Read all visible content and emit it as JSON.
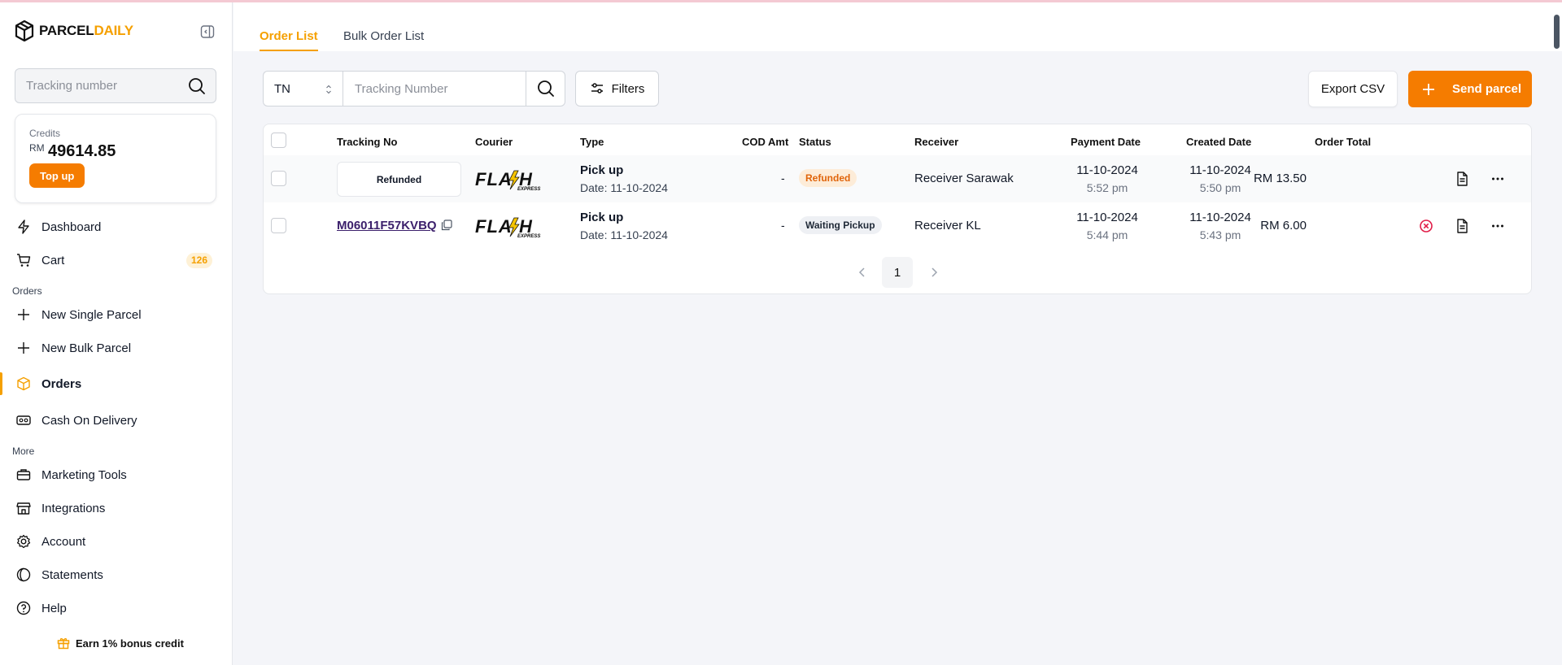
{
  "brand": {
    "part1": "PARCEL",
    "part2": "DAILY"
  },
  "sidebar": {
    "search_placeholder": "Tracking number",
    "credits": {
      "label": "Credits",
      "currency": "RM",
      "amount": "49614.85",
      "topup_label": "Top up"
    },
    "items": [
      {
        "label": "Dashboard",
        "icon": "lightning-icon"
      },
      {
        "label": "Cart",
        "icon": "cart-icon",
        "badge": "126"
      },
      {
        "label": "New Single Parcel",
        "icon": "plus-icon"
      },
      {
        "label": "New Bulk Parcel",
        "icon": "plus-icon"
      },
      {
        "label": "Orders",
        "icon": "box-icon",
        "active": true
      },
      {
        "label": "Cash On Delivery",
        "icon": "cod-icon"
      },
      {
        "label": "Marketing Tools",
        "icon": "briefcase-icon"
      },
      {
        "label": "Integrations",
        "icon": "store-icon"
      },
      {
        "label": "Account",
        "icon": "gear-icon"
      },
      {
        "label": "Statements",
        "icon": "statements-icon"
      },
      {
        "label": "Help",
        "icon": "help-icon"
      }
    ],
    "section_orders": "Orders",
    "section_more": "More",
    "earn_label": "Earn 1% bonus credit"
  },
  "tabs": [
    {
      "label": "Order List",
      "active": true
    },
    {
      "label": "Bulk Order List",
      "active": false
    }
  ],
  "toolbar": {
    "search_type": "TN",
    "search_placeholder": "Tracking Number",
    "filters_label": "Filters",
    "export_label": "Export CSV",
    "send_label": "Send parcel"
  },
  "table": {
    "headers": {
      "tracking": "Tracking No",
      "courier": "Courier",
      "type": "Type",
      "cod": "COD Amt",
      "status": "Status",
      "receiver": "Receiver",
      "payment_date": "Payment Date",
      "created_date": "Created Date",
      "total": "Order Total"
    },
    "rows": [
      {
        "tracking": "Refunded",
        "courier": "FLASH EXPRESS",
        "type": "Pick up",
        "type_date": "Date: 11-10-2024",
        "cod": "-",
        "status": "Refunded",
        "receiver": "Receiver Sarawak",
        "payment_date": "11-10-2024",
        "payment_time": "5:52 pm",
        "created_date": "11-10-2024",
        "created_time": "5:50 pm",
        "total": "RM 13.50"
      },
      {
        "tracking": "M06011F57KVBQ",
        "courier": "FLASH EXPRESS",
        "type": "Pick up",
        "type_date": "Date: 11-10-2024",
        "cod": "-",
        "status": "Waiting Pickup",
        "receiver": "Receiver KL",
        "payment_date": "11-10-2024",
        "payment_time": "5:44 pm",
        "created_date": "11-10-2024",
        "created_time": "5:43 pm",
        "total": "RM 6.00"
      }
    ]
  },
  "pagination": {
    "current": "1"
  },
  "colors": {
    "accent": "#f57c00",
    "brand_yellow": "#f5a000",
    "refunded_badge": "#e0640a"
  }
}
